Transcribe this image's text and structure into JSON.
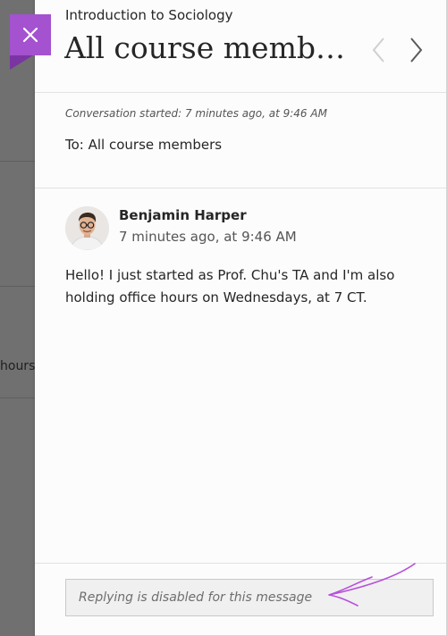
{
  "background": {
    "partial_text": "hours"
  },
  "header": {
    "course_title": "Introduction to Sociology",
    "title": "All course membe...",
    "close_icon": "close-icon",
    "prev_icon": "chevron-left-icon",
    "next_icon": "chevron-right-icon"
  },
  "conversation": {
    "started": "Conversation started: 7 minutes ago, at 9:46 AM",
    "to": "To: All course members"
  },
  "message": {
    "author": "Benjamin Harper",
    "time": "7 minutes ago, at 9:46 AM",
    "body": "Hello! I just started as Prof. Chu's TA and I'm also holding office hours on Wednesdays, at 7 CT."
  },
  "reply": {
    "placeholder": "Replying is disabled for this message"
  },
  "colors": {
    "accent": "#a452d0",
    "annotation": "#b84fdc"
  }
}
